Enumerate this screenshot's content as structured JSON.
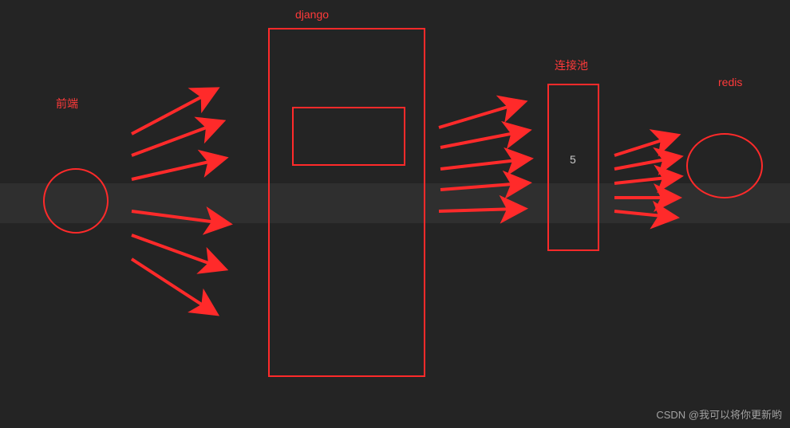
{
  "labels": {
    "frontend": "前端",
    "django": "django",
    "pool": "连接池",
    "redis": "redis"
  },
  "pool_size": "5",
  "watermark": "CSDN @我可以将你更新哟",
  "colors": {
    "stroke": "#ff2a2a",
    "text_red": "#ff3a3a",
    "text_grey": "#c9c9c9",
    "bg": "#242424"
  }
}
